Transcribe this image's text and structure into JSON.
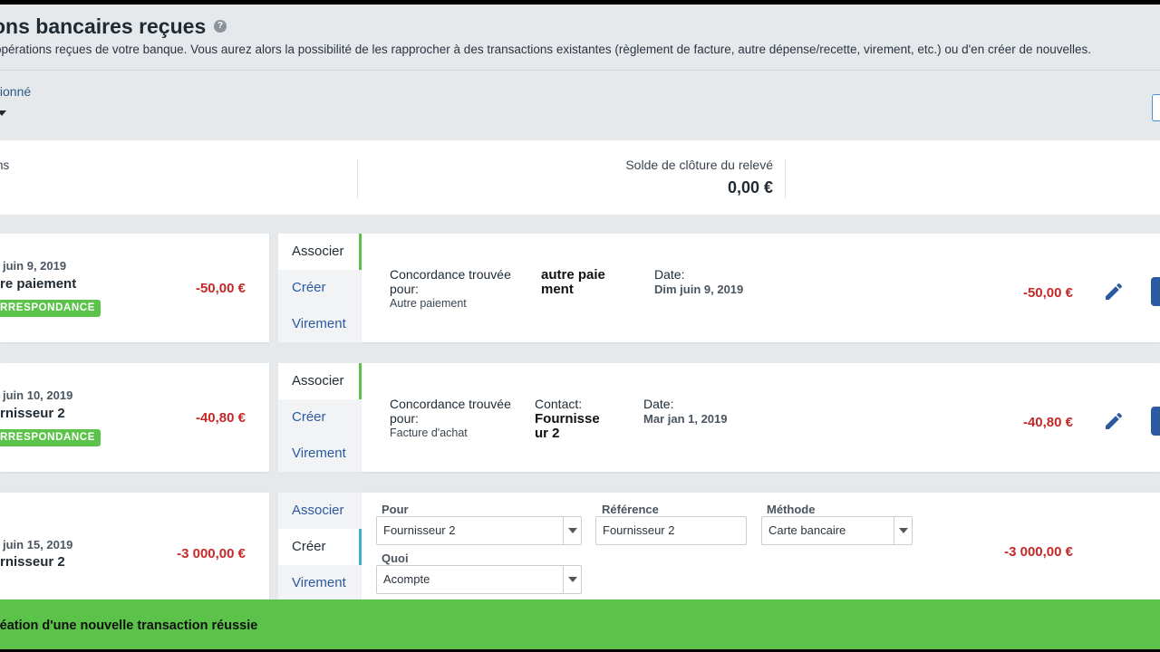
{
  "header": {
    "title": "ons bancaires reçues",
    "help_icon": "?",
    "subtitle": "opérations reçues de votre banque. Vous aurez alors la possibilité de les rapprocher à des transactions existantes (règlement de facture, autre dépense/recette, virement, etc.) ou d'en créer de nouvelles.",
    "account_label": "tionné"
  },
  "summary": {
    "left_label": "ns",
    "closing_label": "Solde de clôture du relevé",
    "closing_value": "0,00 €"
  },
  "tabs": {
    "associate": "Associer",
    "create": "Créer",
    "transfer": "Virement"
  },
  "rows": [
    {
      "date": "juin 9, 2019",
      "label": "re paiement",
      "badge": "RRESPONDANCE",
      "amount": "-50,00 €",
      "active_tab": "associate",
      "match_label": "Concordance trouvée pour:",
      "match_type": "Autre paiement",
      "col2_label": "",
      "col2_value": "autre paie ment",
      "date_label": "Date:",
      "date_value": "Dim juin 9, 2019",
      "detail_amount": "-50,00 €"
    },
    {
      "date": "juin 10, 2019",
      "label": "rnisseur 2",
      "badge": "RRESPONDANCE",
      "amount": "-40,80 €",
      "active_tab": "associate",
      "match_label": "Concordance trouvée pour:",
      "match_type": "Facture d'achat",
      "col2_label": "Contact:",
      "col2_value": "Fournisse ur 2",
      "date_label": "Date:",
      "date_value": "Mar jan 1, 2019",
      "detail_amount": "-40,80 €"
    },
    {
      "date": "juin 15, 2019",
      "label": "rnisseur 2",
      "amount": "-3 000,00 €",
      "active_tab": "create",
      "form": {
        "pour_label": "Pour",
        "pour_value": "Fournisseur 2",
        "reference_label": "Référence",
        "reference_value": "Fournisseur 2",
        "methode_label": "Méthode",
        "methode_value": "Carte bancaire",
        "quoi_label": "Quoi",
        "quoi_value": "Acompte"
      },
      "detail_amount": "-3 000,00 €"
    }
  ],
  "toast": {
    "message": "réation d'une nouvelle transaction réussie"
  },
  "colors": {
    "success_green": "#5cc34a",
    "negative_red": "#c62828",
    "link_blue": "#2c5aa0"
  }
}
